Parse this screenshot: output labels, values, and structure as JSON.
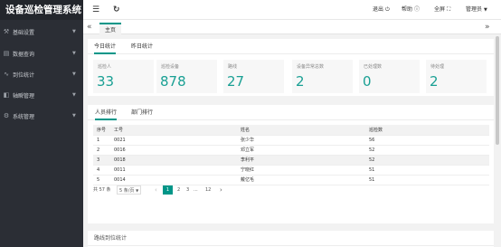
{
  "app": {
    "title": "设备巡检管理系统"
  },
  "sidebar": {
    "items": [
      {
        "icon": "⚒",
        "label": "基础设置"
      },
      {
        "icon": "▤",
        "label": "数据查询"
      },
      {
        "icon": "∿",
        "label": "到位统计"
      },
      {
        "icon": "◧",
        "label": "轴瞬管理"
      },
      {
        "icon": "⚙",
        "label": "系统管理"
      }
    ]
  },
  "topbar": {
    "menu_icon": "☰",
    "refresh_icon": "↻",
    "logout_label": "退出",
    "help_label": "帮助",
    "fullscreen_label": "全屏",
    "user_label": "管理员"
  },
  "tabbar": {
    "home_label": "主页"
  },
  "stats_panel": {
    "tabs": [
      "今日统计",
      "昨日统计"
    ],
    "stats": [
      {
        "label": "巡检人",
        "value": "33"
      },
      {
        "label": "巡检设备",
        "value": "878"
      },
      {
        "label": "路线",
        "value": "27"
      },
      {
        "label": "设备异常总数",
        "value": "2"
      },
      {
        "label": "已处理数",
        "value": "0"
      },
      {
        "label": "待处理",
        "value": "2"
      }
    ]
  },
  "ranking_panel": {
    "tabs": [
      "人员排行",
      "部门排行"
    ],
    "columns": [
      "序号",
      "工号",
      "姓名",
      "巡检数"
    ],
    "rows": [
      {
        "no": "1",
        "id": "0021",
        "name": "张少华",
        "count": "56"
      },
      {
        "no": "2",
        "id": "0016",
        "name": "邓立军",
        "count": "52"
      },
      {
        "no": "3",
        "id": "0018",
        "name": "李利平",
        "count": "52"
      },
      {
        "no": "4",
        "id": "0011",
        "name": "宁晓红",
        "count": "51"
      },
      {
        "no": "5",
        "id": "0014",
        "name": "戴亿毛",
        "count": "51"
      }
    ],
    "pager": {
      "total": "共 57 条",
      "page_size": "5 条/页",
      "prev": "‹",
      "pages": [
        "1",
        "2",
        "3",
        "...",
        "12"
      ],
      "next": "›"
    }
  },
  "route_panel": {
    "title": "路线到位统计"
  },
  "colors": {
    "accent": "#009688",
    "sidebar": "#2b2e35",
    "stat_value": "#1aa094"
  }
}
